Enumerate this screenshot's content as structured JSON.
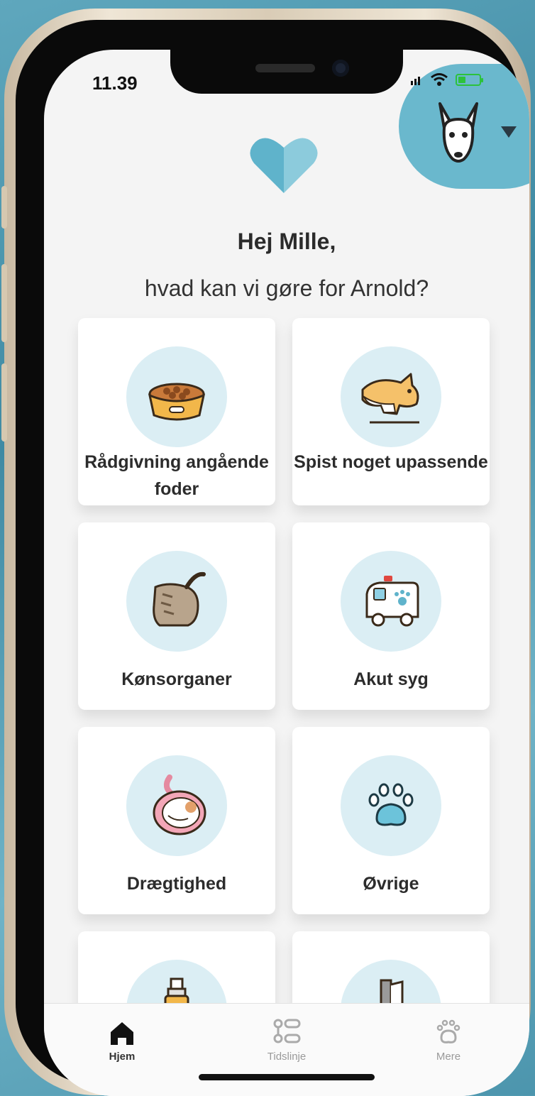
{
  "status": {
    "time": "11.39",
    "battery_level": 0.35
  },
  "header": {
    "greeting": "Hej Mille,",
    "question": "hvad kan vi gøre for Arnold?"
  },
  "colors": {
    "accent": "#6ab8cd",
    "icon_circle": "#dbeef4",
    "screen_bg": "#f4f4f4"
  },
  "categories": [
    {
      "label": "Rådgivning angående foder",
      "icon": "food-bowl-icon"
    },
    {
      "label": "Spist noget upassende",
      "icon": "cat-eating-icon"
    },
    {
      "label": "Kønsorganer",
      "icon": "pet-rear-icon"
    },
    {
      "label": "Akut syg",
      "icon": "ambulance-icon"
    },
    {
      "label": "Drægtighed",
      "icon": "pregnancy-icon"
    },
    {
      "label": "Øvrige",
      "icon": "paw-icon"
    },
    {
      "label": "",
      "icon": "medicine-bottle-icon"
    },
    {
      "label": "",
      "icon": "brush-icon"
    }
  ],
  "tabs": [
    {
      "label": "Hjem",
      "icon": "home-icon",
      "active": true
    },
    {
      "label": "Tidslinje",
      "icon": "timeline-icon",
      "active": false
    },
    {
      "label": "Mere",
      "icon": "paw-icon",
      "active": false
    }
  ]
}
